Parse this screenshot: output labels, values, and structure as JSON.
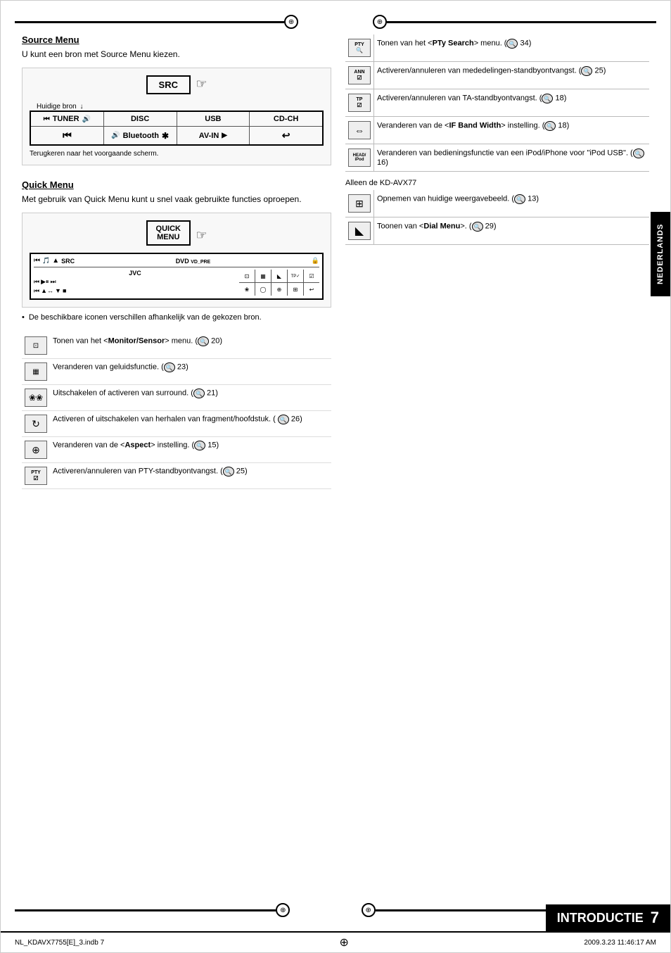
{
  "page": {
    "title": "INTRODUCTIE",
    "page_number": "7",
    "bottom_left": "NL_KDAVX7755[E]_3.indb  7",
    "bottom_right": "2009.3.23  11:46:17 AM"
  },
  "left_column": {
    "source_menu": {
      "title": "Source Menu",
      "description": "U kunt een bron met Source Menu kiezen.",
      "src_label": "SRC",
      "huidige_bron": "Huidige bron",
      "terugkeren": "Terugkeren naar het voorgaande scherm.",
      "sources": [
        [
          "TUNER",
          "DISC",
          "USB",
          "CD-CH"
        ],
        [
          "Bluetooth",
          "AV-IN"
        ]
      ]
    },
    "quick_menu": {
      "title": "Quick Menu",
      "description": "Met gebruik van Quick Menu kunt u snel vaak gebruikte functies oproepen.",
      "label": "QUICK MENU",
      "bullet": "De beschikbare iconen verschillen afhankelijk van de gekozen bron."
    }
  },
  "left_icon_rows": [
    {
      "icon_label": "monitor",
      "icon_text": "⊡",
      "description": "Tonen van het <Monitor/Sensor> menu. (🔍 20)"
    },
    {
      "icon_label": "sound",
      "icon_text": "▦",
      "description": "Veranderen van geluidsfunctie. (🔍 23)"
    },
    {
      "icon_label": "surround",
      "icon_text": "❀",
      "description": "Uitschakelen of activeren van surround. (🔍 21)"
    },
    {
      "icon_label": "repeat",
      "icon_text": "↻",
      "description": "Activeren of uitschakelen van herhalen van fragment/hoofdstuk. ( 🔍 26)"
    },
    {
      "icon_label": "aspect",
      "icon_text": "⊕",
      "description": "Veranderen van de <Aspect> instelling. (🔍 15)"
    },
    {
      "icon_label": "pty-check",
      "icon_text": "PTY✓",
      "description": "Activeren/annuleren van PTY-standbyontvangst. (🔍 25)"
    }
  ],
  "right_icon_rows": [
    {
      "icon_label": "pty-search",
      "icon_text": "PTY",
      "description": "Tonen van het <PTy Search> menu. (🔍 34)"
    },
    {
      "icon_label": "ann-check",
      "icon_text": "ANN✓",
      "description": "Activeren/annuleren van mededelingen-standbyontvangst. (🔍 25)"
    },
    {
      "icon_label": "tp-check",
      "icon_text": "TP✓",
      "description": "Activeren/annuleren van TA-standbyontvangst. (🔍 18)"
    },
    {
      "icon_label": "if-band",
      "icon_text": "⇔",
      "description": "Veranderen van de <IF Band Width> instelling. (🔍 18)"
    },
    {
      "icon_label": "head-ipod",
      "icon_text": "HEAD/iPod",
      "description": "Veranderen van bedieningsfunctie van een iPod/iPhone voor \"iPod USB\". (🔍 16)"
    }
  ],
  "only_kdavx77": {
    "label": "Alleen de KD-AVX77",
    "rows": [
      {
        "icon_label": "capture",
        "icon_text": "⊞",
        "description": "Opnemen van huidige weergavebeeld. (🔍 13)"
      },
      {
        "icon_label": "dial-menu",
        "icon_text": "◣",
        "description": "Toonen van <Dial Menu>. (🔍 29)"
      }
    ]
  },
  "sidebar": {
    "text": "NEDERLANDS"
  },
  "bold_terms": {
    "monitor_sensor": "Monitor/Sensor",
    "aspect": "Aspect",
    "if_band_width": "IF Band Width",
    "dial_menu": "Dial Menu",
    "pty_search": "PTy Search"
  }
}
